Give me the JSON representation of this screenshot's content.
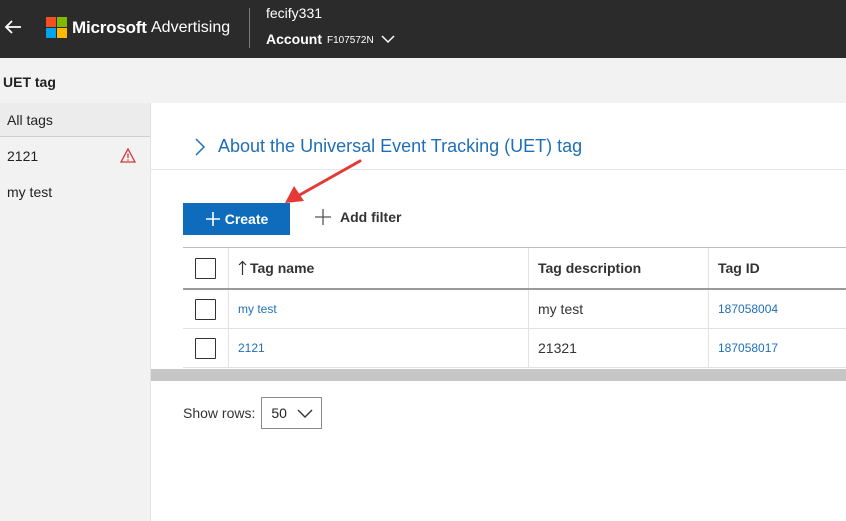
{
  "header": {
    "brand": "Microsoft",
    "product": "Advertising",
    "user": "fecify331",
    "account_label": "Account",
    "account_id": "F107572N"
  },
  "page": {
    "title": "UET tag"
  },
  "sidebar": {
    "items": [
      {
        "label": "All tags"
      },
      {
        "label": "2121",
        "warning": true
      },
      {
        "label": "my test"
      }
    ]
  },
  "main": {
    "about_link": "About the Universal Event Tracking (UET) tag",
    "create_label": "Create",
    "add_filter_label": "Add filter"
  },
  "table": {
    "columns": [
      "Tag name",
      "Tag description",
      "Tag ID"
    ],
    "rows": [
      {
        "name": "my test",
        "description": "my test",
        "id": "187058004"
      },
      {
        "name": "2121",
        "description": "21321",
        "id": "187058017"
      }
    ]
  },
  "pagination": {
    "show_rows_label": "Show rows:",
    "rows_value": "50"
  },
  "colors": {
    "topbar": "#2b2b2b",
    "primary": "#0f6cbd",
    "link": "#1e6fb8",
    "warning": "#d13438",
    "annotation": "#e53935"
  }
}
